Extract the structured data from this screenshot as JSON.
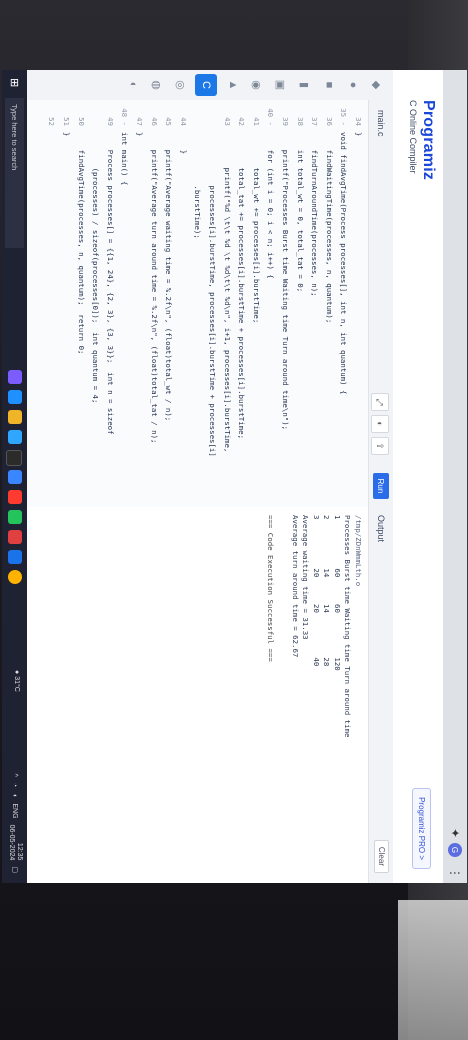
{
  "brand_label": "zebion",
  "app": {
    "brand": "Programiz",
    "subtitle": "C Online Compiler",
    "pro_button": "Programiz PRO >"
  },
  "editor": {
    "file_tab": "main.c",
    "run_label": "Run",
    "lines": [
      {
        "n": "34",
        "t": "}"
      },
      {
        "n": "35 -",
        "t": "void findAvgTime(Process processes[], int n, int quantum) {"
      },
      {
        "n": "36",
        "t": "    findWaitingTime(processes, n, quantum);"
      },
      {
        "n": "37",
        "t": "    findTurnAroundTime(processes, n);"
      },
      {
        "n": "38",
        "t": "    int total_wt = 0, total_tat = 0;"
      },
      {
        "n": "39",
        "t": "    printf(\"Processes Burst time Waiting time Turn around time\\n\");"
      },
      {
        "n": "40 -",
        "t": "    for (int i = 0; i < n; i++) {"
      },
      {
        "n": "41",
        "t": "        total_wt += processes[i].burstTime;"
      },
      {
        "n": "42",
        "t": "        total_tat += processes[i].burstTime + processes[i].burstTime;"
      },
      {
        "n": "43",
        "t": "        printf(\"%d \\t\\t %d \\t %d\\t\\t %d\\n\", i+1, processes[i].burstTime,"
      },
      {
        "n": "",
        "t": "            processes[i].burstTime, processes[i].burstTime + processes[i]"
      },
      {
        "n": "",
        "t": "            .burstTime);"
      },
      {
        "n": "44",
        "t": "    }"
      },
      {
        "n": "45",
        "t": "    printf(\"Average waiting time = %.2f\\n\", (float)total_wt / n);"
      },
      {
        "n": "46",
        "t": "    printf(\"Average turn around time = %.2f\\n\", (float)total_tat / n);"
      },
      {
        "n": "47",
        "t": "}"
      },
      {
        "n": "48 -",
        "t": "int main() {"
      },
      {
        "n": "49",
        "t": "    Process processes[] = {{1, 24}, {2, 3}, {3, 3}};  int n = sizeof"
      },
      {
        "n": "",
        "t": "        (processes) / sizeof(processes[0]);  int quantum = 4;"
      },
      {
        "n": "50",
        "t": "    findAvgTime(processes, n, quantum);  return 0;"
      },
      {
        "n": "51",
        "t": "}"
      },
      {
        "n": "52",
        "t": ""
      }
    ]
  },
  "output": {
    "title": "Output",
    "clear_label": "Clear",
    "lines": [
      "/tmp/ZDnWmmLth.o",
      "Processes Burst time Waiting time Turn around time",
      "1           60      60          120",
      "2           14      14          28",
      "3           20      20          40",
      "Average waiting time = 31.33",
      "Average turn around time = 62.67",
      "",
      "=== Code Execution Successful ==="
    ]
  },
  "taskbar": {
    "search_placeholder": "Type here to search",
    "weather": "31°C",
    "time": "12:35",
    "date": "06-05-2024",
    "lang": "ENG"
  }
}
